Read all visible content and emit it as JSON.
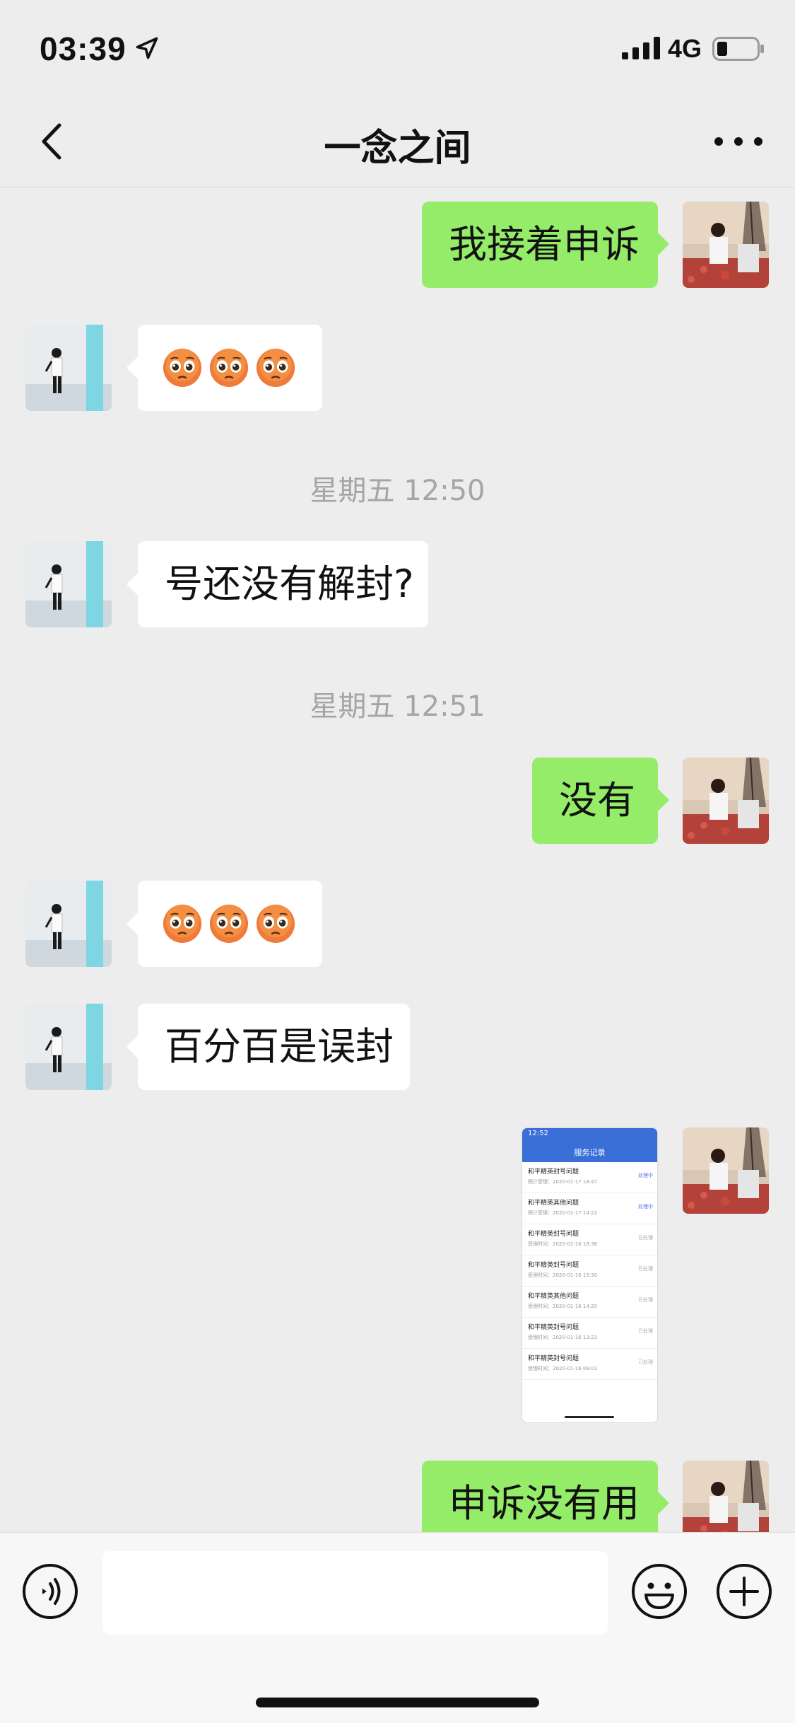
{
  "status_bar": {
    "time": "03:39",
    "network": "4G"
  },
  "nav": {
    "title": "一念之间"
  },
  "messages": {
    "m1": {
      "text": "我接着申诉"
    },
    "t1": {
      "text": "星期五 12:50"
    },
    "m3": {
      "text": "号还没有解封?"
    },
    "t2": {
      "text": "星期五 12:51"
    },
    "m4": {
      "text": "没有"
    },
    "m6": {
      "text": "百分百是误封"
    },
    "m8": {
      "text": "申诉没有用"
    }
  },
  "screenshot_image": {
    "time": "12:52",
    "title": "服务记录",
    "rows": [
      {
        "title": "和平精英封号问题",
        "date": "预计受理：2020-01-17 18:47",
        "status": "处理中"
      },
      {
        "title": "和平精英其他问题",
        "date": "预计受理：2020-01-17 14:22",
        "status": "处理中"
      },
      {
        "title": "和平精英封号问题",
        "date": "受理时间：2020-01-16 18:36",
        "status": "已处理"
      },
      {
        "title": "和平精英封号问题",
        "date": "受理时间：2020-01-16 15:30",
        "status": "已处理"
      },
      {
        "title": "和平精英其他问题",
        "date": "受理时间：2020-01-16 14:20",
        "status": "已处理"
      },
      {
        "title": "和平精英封号问题",
        "date": "受理时间：2020-01-16 13:23",
        "status": "已处理"
      },
      {
        "title": "和平精英封号问题",
        "date": "受理时间：2020-01-16 09:01",
        "status": "已处理"
      }
    ]
  },
  "icons": {
    "back": "chevron-left-icon",
    "more": "more-dots-icon",
    "voice": "voice-icon",
    "emoji": "emoji-icon",
    "plus": "plus-icon",
    "reaction_emoji": "pleading-face-emoji"
  },
  "colors": {
    "background": "#ededed",
    "outgoing_bubble": "#95ec69",
    "incoming_bubble": "#ffffff",
    "timestamp": "#a5a5a5"
  }
}
